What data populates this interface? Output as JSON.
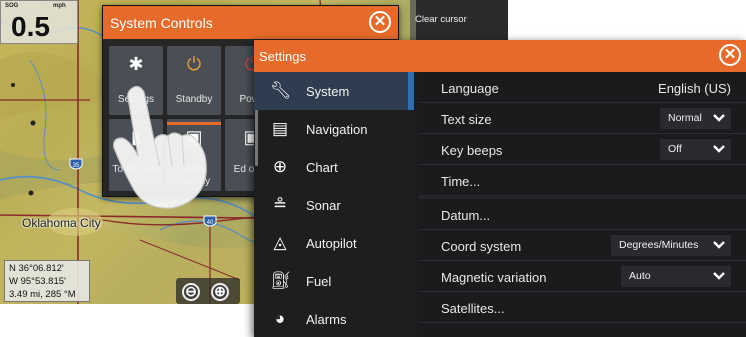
{
  "map": {
    "speed_label": "SOG",
    "speed_unit": "mph",
    "speed_value": "0.5",
    "city_label": "Oklahoma City",
    "coord_lat": "N  36°06.812'",
    "coord_lon": "W  95°53.815'",
    "coord_range": "3.49 mi, 285 °M",
    "zoom_out_symbol": "⊖",
    "zoom_in_symbol": "⊕",
    "right_strip_label": "Clear cursor",
    "highway_shields": [
      "35",
      "40"
    ]
  },
  "system_controls": {
    "title": "System Controls",
    "close_symbol": "✕",
    "tiles": [
      {
        "label": "Settings",
        "icon": "gear-icon"
      },
      {
        "label": "Standby",
        "icon": "power-icon"
      },
      {
        "label": "Powe",
        "icon": "power-off-icon"
      },
      {
        "label": "Touch lock",
        "icon": "touch-lock-icon"
      },
      {
        "label": "Data overlay",
        "icon": "data-overlay-icon"
      },
      {
        "label": "Ed overl",
        "icon": "edit-overlay-icon"
      }
    ]
  },
  "settings": {
    "title": "Settings",
    "close_symbol": "✕",
    "sidebar": [
      {
        "label": "System",
        "icon": "wrench-icon",
        "active": true
      },
      {
        "label": "Navigation",
        "icon": "navigation-icon"
      },
      {
        "label": "Chart",
        "icon": "globe-icon"
      },
      {
        "label": "Sonar",
        "icon": "sonar-icon"
      },
      {
        "label": "Autopilot",
        "icon": "autopilot-icon"
      },
      {
        "label": "Fuel",
        "icon": "fuel-icon"
      },
      {
        "label": "Alarms",
        "icon": "alarm-icon"
      }
    ],
    "rows": [
      {
        "label": "Language",
        "value": "English (US)"
      },
      {
        "label": "Text size",
        "dropdown": "Normal"
      },
      {
        "label": "Key beeps",
        "dropdown": "Off"
      },
      {
        "label": "Time..."
      },
      {
        "label": "Datum..."
      },
      {
        "label": "Coord system",
        "dropdown": "Degrees/Minutes"
      },
      {
        "label": "Magnetic variation",
        "dropdown": "Auto"
      },
      {
        "label": "Satellites..."
      }
    ]
  },
  "colors": {
    "accent": "#e66a2a",
    "active_item": "#2e3d50",
    "panel": "#1b1c1e"
  }
}
